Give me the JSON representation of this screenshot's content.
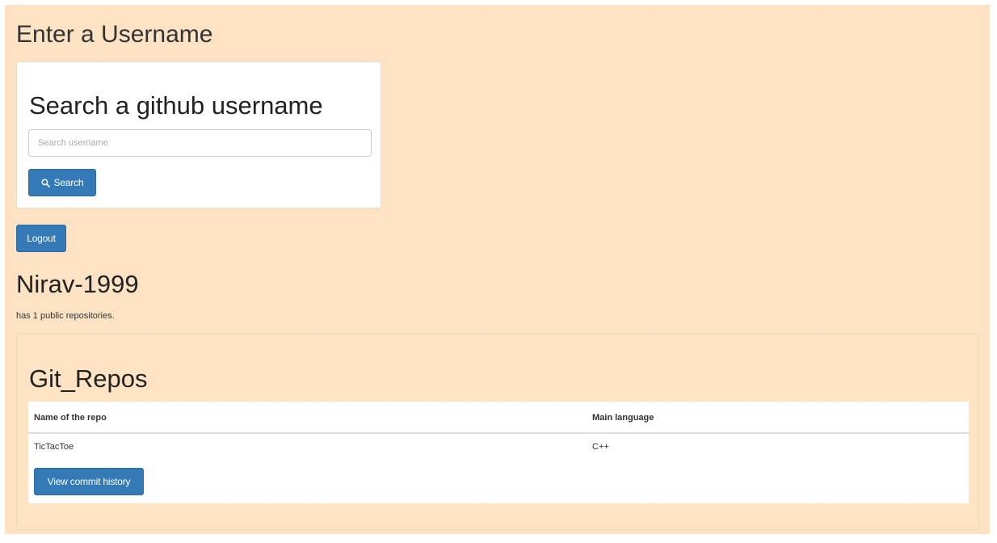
{
  "page": {
    "heading": "Enter a Username"
  },
  "search": {
    "title": "Search a github username",
    "placeholder": "Search username",
    "button_label": "Search",
    "button_icon": "search-icon"
  },
  "logout_label": "Logout",
  "profile": {
    "username": "Nirav-1999",
    "repo_count_text": "has 1 public repositories."
  },
  "repos": {
    "title": "Git_Repos",
    "columns": [
      "Name of the repo",
      "Main language"
    ],
    "rows": [
      {
        "name": "TicTacToe",
        "language": "C++",
        "action_label": "View commit history"
      }
    ]
  },
  "colors": {
    "background": "#fde3c3",
    "primary_button": "#337ab7"
  }
}
